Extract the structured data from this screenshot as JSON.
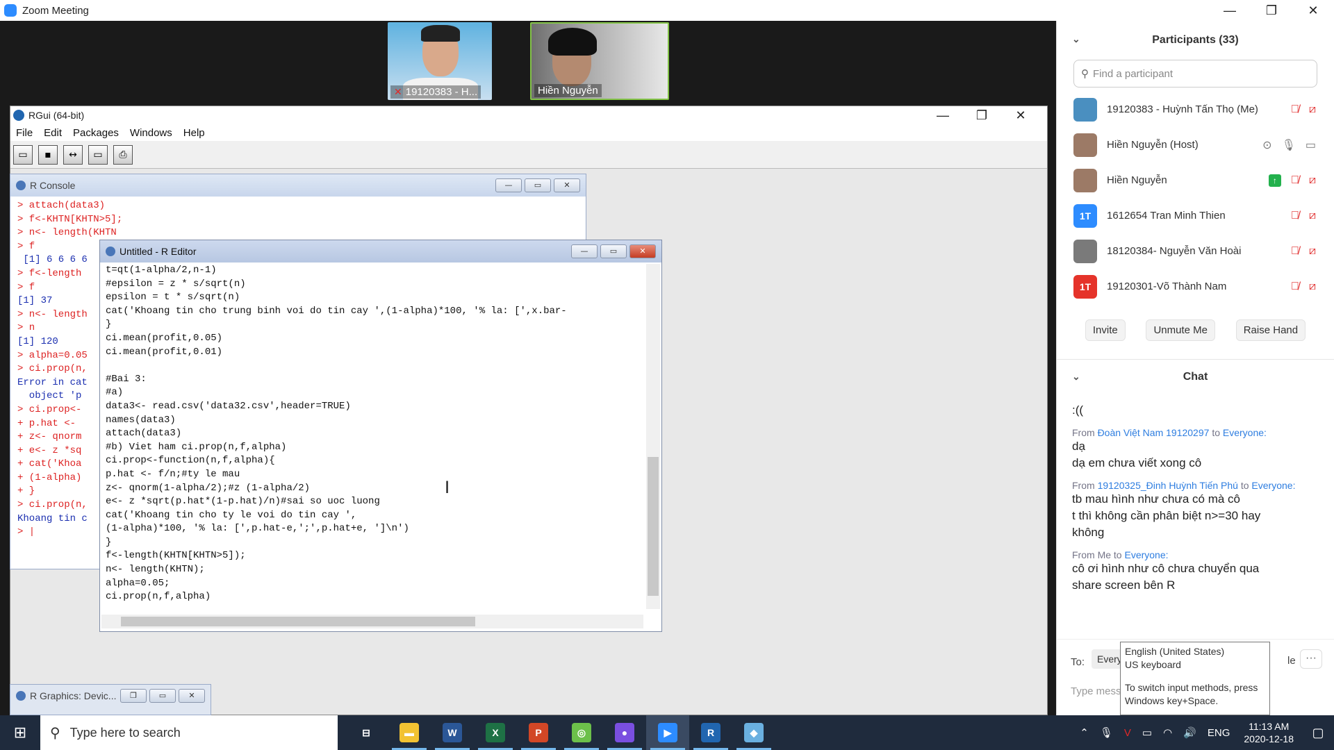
{
  "zoom": {
    "title": "Zoom Meeting",
    "window_controls": [
      "—",
      "❐",
      "✕"
    ]
  },
  "thumbnails": [
    {
      "name": "19120383 - H..."
    },
    {
      "name": "Hiền Nguyễn"
    }
  ],
  "rgui": {
    "title": "RGui (64-bit)",
    "menu": [
      "File",
      "Edit",
      "Packages",
      "Windows",
      "Help"
    ],
    "window_controls": [
      "—",
      "❐",
      "✕"
    ],
    "toolbar": [
      "open",
      "save",
      "load",
      "console",
      "print"
    ]
  },
  "console": {
    "title": "R Console",
    "lines": [
      {
        "text": "> attach(data3)",
        "kind": "cmd"
      },
      {
        "text": "> f<-KHTN[KHTN>5];",
        "kind": "cmd"
      },
      {
        "text": "> n<- length(KHTN",
        "kind": "cmd"
      },
      {
        "text": "> f",
        "kind": "cmd"
      },
      {
        "text": " [1] 6 6 6 6",
        "kind": "out"
      },
      {
        "text": "> f<-length",
        "kind": "cmd"
      },
      {
        "text": "> f",
        "kind": "cmd"
      },
      {
        "text": "[1] 37",
        "kind": "out"
      },
      {
        "text": "> n<- length",
        "kind": "cmd"
      },
      {
        "text": "> n",
        "kind": "cmd"
      },
      {
        "text": "[1] 120",
        "kind": "out"
      },
      {
        "text": "> alpha=0.05",
        "kind": "cmd"
      },
      {
        "text": "> ci.prop(n,",
        "kind": "cmd"
      },
      {
        "text": "Error in cat",
        "kind": "out"
      },
      {
        "text": "  object 'p",
        "kind": "out"
      },
      {
        "text": "> ci.prop<-",
        "kind": "cmd"
      },
      {
        "text": "+ p.hat <- ",
        "kind": "cmd"
      },
      {
        "text": "+ z<- qnorm",
        "kind": "cmd"
      },
      {
        "text": "+ e<- z *sq",
        "kind": "cmd"
      },
      {
        "text": "+ cat('Khoa",
        "kind": "cmd"
      },
      {
        "text": "+ (1-alpha)",
        "kind": "cmd"
      },
      {
        "text": "+ }",
        "kind": "cmd"
      },
      {
        "text": "> ci.prop(n,",
        "kind": "cmd"
      },
      {
        "text": "Khoang tin c",
        "kind": "out"
      },
      {
        "text": "> |",
        "kind": "cmd"
      }
    ]
  },
  "editor": {
    "title": "Untitled - R Editor",
    "code": "t=qt(1-alpha/2,n-1)\n#epsilon = z * s/sqrt(n)\nepsilon = t * s/sqrt(n)\ncat('Khoang tin cho trung binh voi do tin cay ',(1-alpha)*100, '% la: [',x.bar-\n}\nci.mean(profit,0.05)\nci.mean(profit,0.01)\n\n#Bai 3:\n#a)\ndata3<- read.csv('data32.csv',header=TRUE)\nnames(data3)\nattach(data3)\n#b) Viet ham ci.prop(n,f,alpha)\nci.prop<-function(n,f,alpha){\np.hat <- f/n;#ty le mau\nz<- qnorm(1-alpha/2);#z (1-alpha/2)\ne<- z *sqrt(p.hat*(1-p.hat)/n)#sai so uoc luong\ncat('Khoang tin cho ty le voi do tin cay ',\n(1-alpha)*100, '% la: [',p.hat-e,';',p.hat+e, ']\\n')\n}\nf<-length(KHTN[KHTN>5]);\nn<- length(KHTN);\nalpha=0.05;\nci.prop(n,f,alpha)"
  },
  "graphics": {
    "title": "R Graphics: Devic..."
  },
  "participants": {
    "header": "Participants (33)",
    "search_placeholder": "Find a participant",
    "list": [
      {
        "name": "19120383 - Huỳnh Tấn Thọ (Me)",
        "avatar": "",
        "color": "#4a8fc0"
      },
      {
        "name": "Hiền Nguyễn (Host)",
        "avatar": "",
        "color": "#9c7a66"
      },
      {
        "name": "Hiền Nguyễn",
        "avatar": "",
        "color": "#9c7a66"
      },
      {
        "name": "1612654 Tran Minh Thien",
        "avatar": "1T",
        "color": "#2d8cff"
      },
      {
        "name": "18120384- Nguyễn Văn Hoài",
        "avatar": "",
        "color": "#7a7a7a"
      },
      {
        "name": "19120301-Võ Thành Nam",
        "avatar": "1T",
        "color": "#e5332a"
      }
    ],
    "buttons": [
      "Invite",
      "Unmute Me",
      "Raise Hand"
    ]
  },
  "chat": {
    "header": "Chat",
    "first_line": ":((",
    "messages": [
      {
        "from_label": "From",
        "from": "Đoàn Việt Nam 19120297",
        "to_label": "to",
        "to": "Everyone:",
        "lines": [
          "dạ",
          "dạ em chưa viết xong cô"
        ]
      },
      {
        "from_label": "From",
        "from": "19120325_Đinh Huỳnh Tiến Phú",
        "to_label": "to",
        "to": "Everyone:",
        "lines": [
          "tb mau hình như chưa có mà cô",
          "t thì không cần phân biệt n>=30 hay",
          "không"
        ]
      },
      {
        "from_label": "From",
        "from": "Me",
        "to_label": "to",
        "to": "Everyone:",
        "lines": [
          "cô ơi hình như cô chưa chuyển qua",
          "share screen bên R"
        ]
      }
    ],
    "to_label": "To:",
    "to_value": "Everyo",
    "to_trailing": "le",
    "more": "···",
    "input_placeholder": "Type messa"
  },
  "tooltip": {
    "line1": "English (United States)",
    "line2": "US keyboard",
    "line3": "To switch input methods, press",
    "line4": "Windows key+Space."
  },
  "taskbar": {
    "search_placeholder": "Type here to search",
    "apps": [
      {
        "name": "task-view",
        "label": "⊟",
        "color": "transparent"
      },
      {
        "name": "file-explorer",
        "label": "▬",
        "color": "#f2c232"
      },
      {
        "name": "word",
        "label": "W",
        "color": "#2b5797"
      },
      {
        "name": "excel",
        "label": "X",
        "color": "#1e7145"
      },
      {
        "name": "powerpoint",
        "label": "P",
        "color": "#d24726"
      },
      {
        "name": "app-green",
        "label": "◎",
        "color": "#6cc04a"
      },
      {
        "name": "app-drop",
        "label": "●",
        "color": "#7a4fe0"
      },
      {
        "name": "zoom",
        "label": "▶",
        "color": "#2d8cff"
      },
      {
        "name": "r",
        "label": "R",
        "color": "#2166b0"
      },
      {
        "name": "app-blue",
        "label": "◆",
        "color": "#6ab0e0"
      }
    ],
    "language": "ENG",
    "time": "11:13 AM",
    "date": "2020-12-18"
  }
}
